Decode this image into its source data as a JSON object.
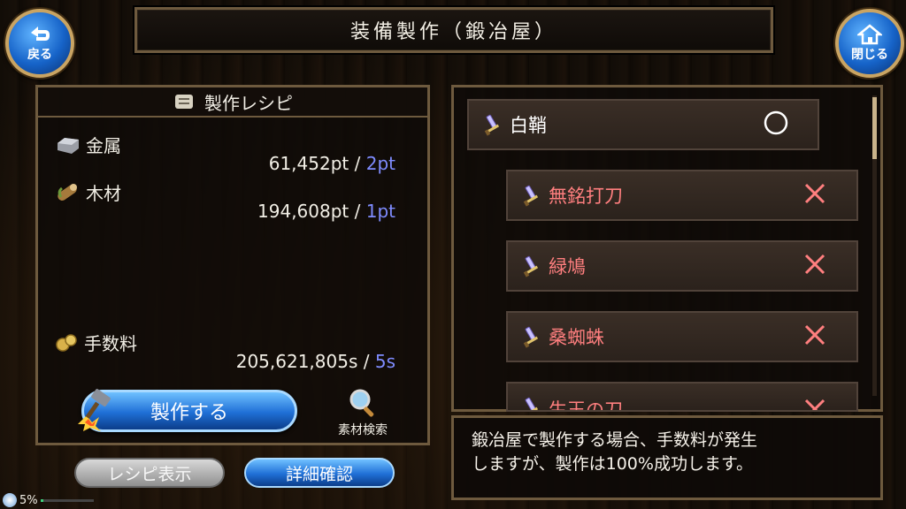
{
  "header": {
    "title": "装備製作（鍛冶屋）",
    "back_label": "戻る",
    "close_label": "閉じる"
  },
  "recipe_panel": {
    "heading": "製作レシピ",
    "materials": [
      {
        "icon": "metal-ingot-icon",
        "label": "金属",
        "owned": "61,452pt",
        "separator": "/",
        "required": "2pt"
      },
      {
        "icon": "wood-log-icon",
        "label": "木材",
        "owned": "194,608pt",
        "separator": "/",
        "required": "1pt"
      }
    ],
    "fee": {
      "icon": "coins-icon",
      "label": "手数料",
      "owned": "205,621,805s",
      "separator": "/",
      "required": "5s"
    },
    "craft_button": "製作する",
    "search_button": "素材検索",
    "recipe_view_button": "レシピ表示",
    "detail_button": "詳細確認"
  },
  "recipe_list": {
    "items": [
      {
        "name": "白鞘",
        "status": "○",
        "craftable": true,
        "level": 0
      },
      {
        "name": "無銘打刀",
        "status": "×",
        "craftable": false,
        "level": 1
      },
      {
        "name": "緑鳩",
        "status": "×",
        "craftable": false,
        "level": 1
      },
      {
        "name": "桑蜘蛛",
        "status": "×",
        "craftable": false,
        "level": 1
      },
      {
        "name": "生王の刀",
        "status": "×",
        "craftable": false,
        "level": 1
      }
    ]
  },
  "message": {
    "line1": "鍛冶屋で製作する場合、手数料が発生",
    "line2": "しますが、製作は100%成功します。"
  },
  "status": {
    "progress_label": "5%",
    "progress_value": 0.05
  },
  "colors": {
    "required": "#7f8cff",
    "not_craftable": "#ff7f7f",
    "craftable": "#ffffff",
    "frame": "#6e5a3e"
  }
}
